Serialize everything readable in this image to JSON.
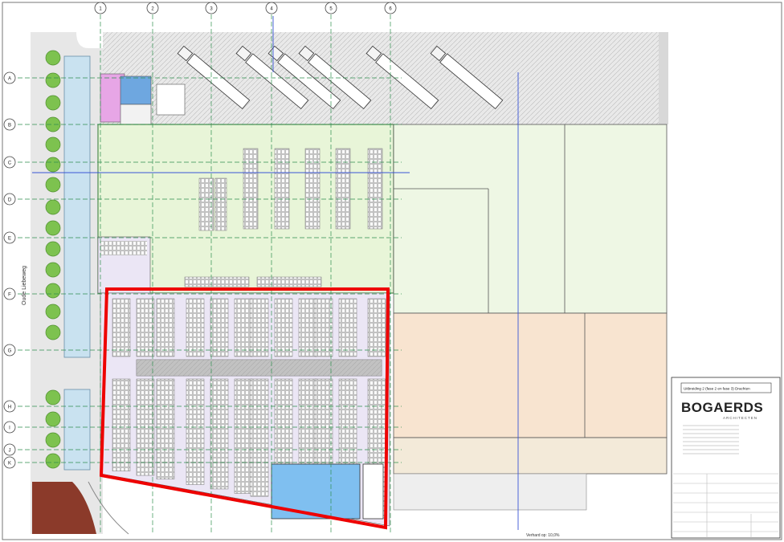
{
  "grid_columns": [
    "1",
    "2",
    "3",
    "4",
    "5",
    "6"
  ],
  "grid_rows": [
    "A",
    "B",
    "C",
    "D",
    "E",
    "F",
    "G",
    "H",
    "I",
    "J",
    "K"
  ],
  "street_label": "Oude Liebeweg",
  "titleblock": {
    "stamp": "Uitbreiding 2 (fase 2 en fase 3) Drachten",
    "brand": "BOGAERDS",
    "brand_sub": "ARCHITECTEN"
  },
  "scale_note": "Verhard op: 10,0%",
  "colors": {
    "hall_green": "#e8f5d8",
    "office_green": "#eef7e4",
    "storage_peach": "#f8e4d0",
    "mezz_lavender": "#ebe6f5",
    "highlight_red": "#ee0000",
    "water_blue": "#c9e2f0",
    "tree_green": "#7dc24f",
    "blue_room": "#7fbff0",
    "brick": "#8b3a2a"
  }
}
